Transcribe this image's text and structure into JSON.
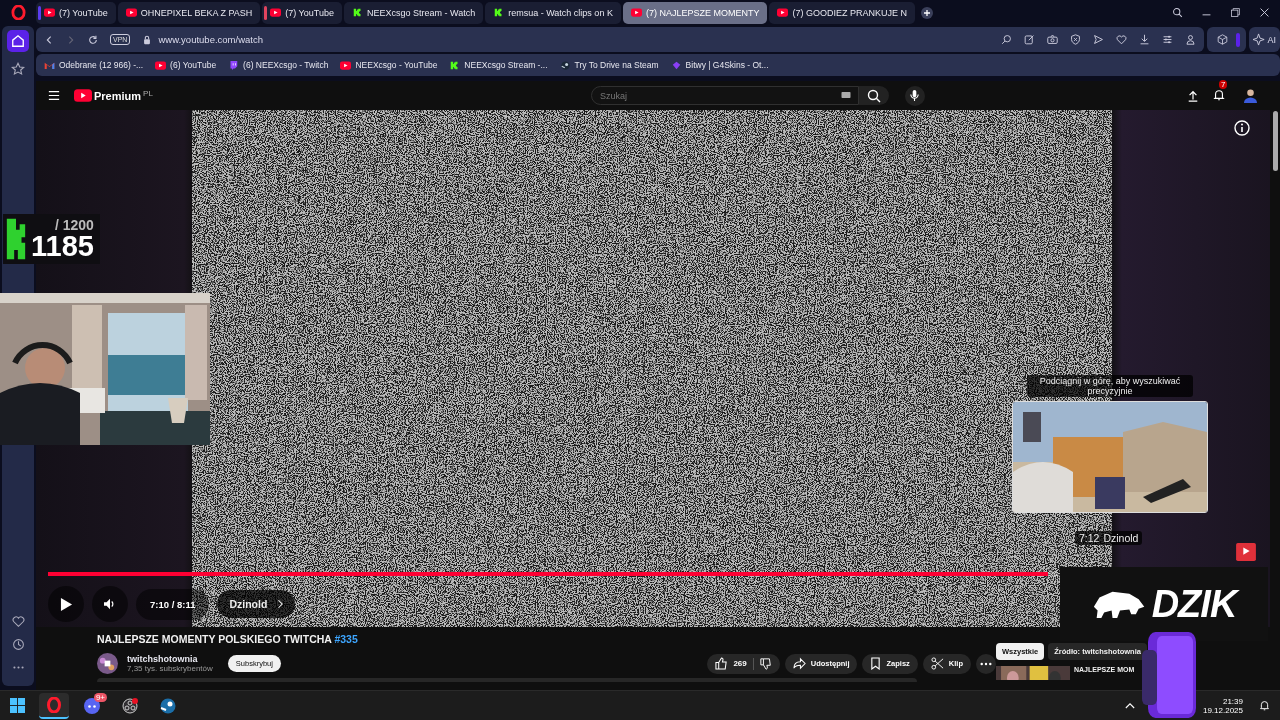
{
  "browser_sidebar": {
    "items": [
      {
        "kind": "home",
        "selected": true
      },
      {
        "kind": "bookmarks",
        "selected": false
      }
    ]
  },
  "tabs": [
    {
      "title": "(7) YouTube",
      "kind": "youtube",
      "selected": false,
      "color": "#5b3cf0"
    },
    {
      "title": "OHNEPIXEL BEKA Z PASH",
      "kind": "youtube",
      "selected": false
    },
    {
      "title": "(7) YouTube",
      "kind": "youtube",
      "selected": false,
      "color": "#e0445e"
    },
    {
      "title": "NEEXcsgo Stream - Watch",
      "kind": "kick",
      "selected": false
    },
    {
      "title": "remsua - Watch clips on K",
      "kind": "kick",
      "selected": false
    },
    {
      "title": "(7) NAJLEPSZE MOMENTY",
      "kind": "youtube",
      "selected": true
    },
    {
      "title": "(7) GOODIEZ PRANKUJE N",
      "kind": "youtube",
      "selected": false
    }
  ],
  "address_bar": {
    "vpn": "VPN",
    "url": "www.youtube.com/watch",
    "ai": "AI"
  },
  "bookmarks": [
    {
      "title": "Odebrane (12 966) -...",
      "kind": "gmail"
    },
    {
      "title": "(6) YouTube",
      "kind": "youtube"
    },
    {
      "title": "(6) NEEXcsgo - Twitch",
      "kind": "twitch"
    },
    {
      "title": "NEEXcsgo - YouTube",
      "kind": "youtube"
    },
    {
      "title": "NEEXcsgo Stream -...",
      "kind": "kick"
    },
    {
      "title": "Try To Drive na Steam",
      "kind": "steam"
    },
    {
      "title": "Bitwy | G4Skins - Ot...",
      "kind": "gem"
    }
  ],
  "youtube_header": {
    "logo": "Premium",
    "region": "PL",
    "search_placeholder": "Szukaj",
    "notifications": "7"
  },
  "stream_overlay": {
    "total": "/ 1200",
    "count": "1185"
  },
  "preview": {
    "hint": "Podciągnij w górę, aby wyszukiwać precyzyjnie",
    "time": "7:12",
    "chapter": "Dzinold"
  },
  "player": {
    "level": 0.99,
    "time": "7:10 / 8:11",
    "chapter": "Dzinold"
  },
  "sponsor": {
    "logo": "DZIK"
  },
  "video": {
    "title": "NAJLEPSZE MOMENTY POLSKIEGO TWITCHA",
    "hashtag": "#335",
    "channel": "twitchshotownia",
    "subscribers": "7,35 tys. subskrybentów",
    "subscribe": "Subskrybuj",
    "likes": "269",
    "share": "Udostępnij",
    "save": "Zapisz",
    "clip": "Klip"
  },
  "chips": [
    {
      "label": "Wszystkie",
      "selected": true
    },
    {
      "label": "Źródło: twitchshotownia",
      "selected": false
    }
  ],
  "recommendation": {
    "title": "NAJLEPSZE MOM"
  },
  "taskbar": {
    "apps": [
      {
        "kind": "opera",
        "selected": true
      },
      {
        "kind": "discord",
        "selected": false,
        "badge": "9+"
      },
      {
        "kind": "obs",
        "selected": false
      },
      {
        "kind": "steam",
        "selected": false
      }
    ],
    "time": "21:39",
    "date": "19.12.2025"
  }
}
